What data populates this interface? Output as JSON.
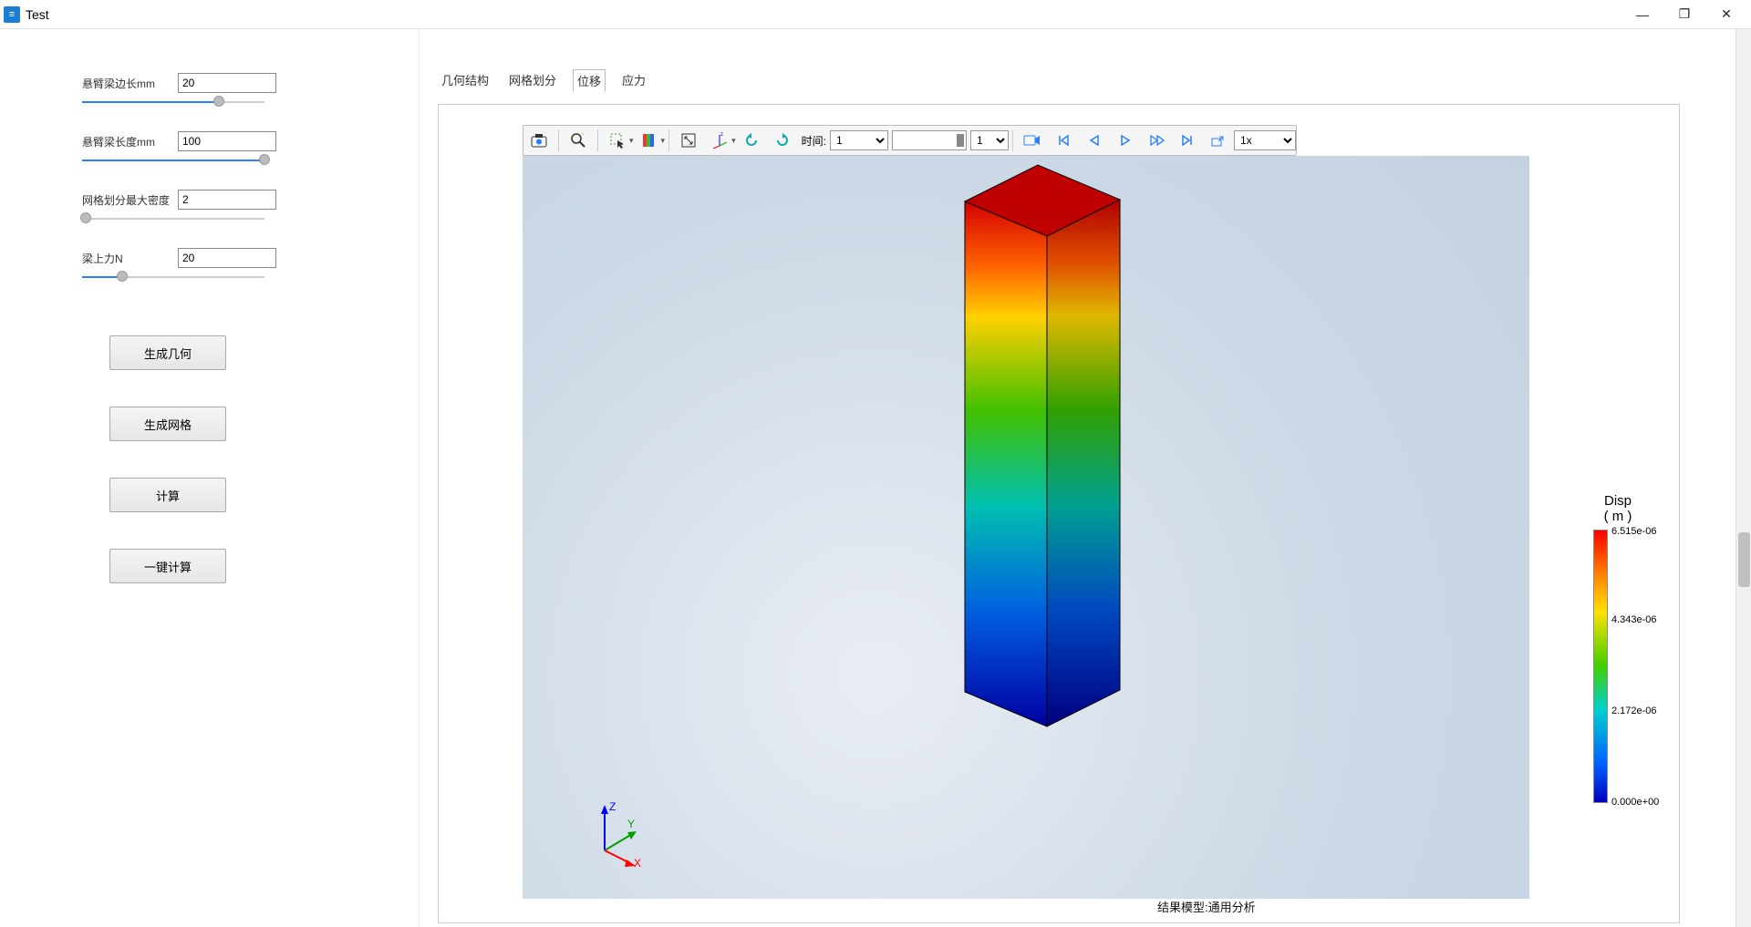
{
  "window": {
    "title": "Test"
  },
  "params": {
    "p1": {
      "label": "悬臂梁边长mm",
      "value": "20",
      "fill": 75,
      "thumb": 75
    },
    "p2": {
      "label": "悬臂梁长度mm",
      "value": "100",
      "fill": 100,
      "thumb": 100
    },
    "p3": {
      "label": "网格划分最大密度",
      "value": "2",
      "fill": 0,
      "thumb": 2
    },
    "p4": {
      "label": "梁上力N",
      "value": "20",
      "fill": 22,
      "thumb": 22
    }
  },
  "buttons": {
    "b1": "生成几何",
    "b2": "生成网格",
    "b3": "计算",
    "b4": "一键计算"
  },
  "tabs": {
    "t1": "几何结构",
    "t2": "网格划分",
    "t3": "位移",
    "t4": "应力",
    "active": "t3"
  },
  "toolbar": {
    "time_label": "时间:",
    "time_value": "1",
    "frame_value": "1",
    "speed_value": "1x"
  },
  "legend": {
    "title_line1": "Disp",
    "title_line2": "( m )",
    "ticks": {
      "t0": "6.515e-06",
      "t1": "4.343e-06",
      "t2": "2.172e-06",
      "t3": "0.000e+00"
    }
  },
  "triad": {
    "x": "X",
    "y": "Y",
    "z": "Z"
  },
  "caption": "结果模型:通用分析"
}
